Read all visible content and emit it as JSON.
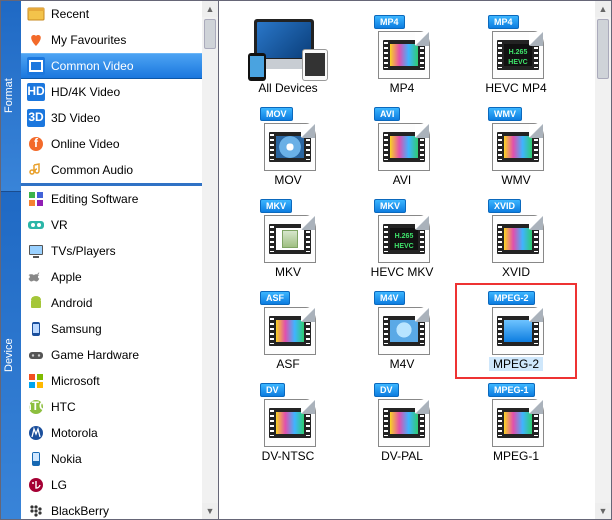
{
  "rails": {
    "format": "Format",
    "device": "Device"
  },
  "sidebar": {
    "format_items": [
      {
        "label": "Recent",
        "icon": "recent-icon"
      },
      {
        "label": "My Favourites",
        "icon": "heart-icon"
      },
      {
        "label": "Common Video",
        "icon": "video-icon",
        "selected": true
      },
      {
        "label": "HD/4K Video",
        "icon": "hd-icon"
      },
      {
        "label": "3D Video",
        "icon": "3d-icon"
      },
      {
        "label": "Online Video",
        "icon": "online-icon"
      },
      {
        "label": "Common Audio",
        "icon": "audio-icon"
      }
    ],
    "device_items": [
      {
        "label": "Editing Software",
        "icon": "editing-icon"
      },
      {
        "label": "VR",
        "icon": "vr-icon"
      },
      {
        "label": "TVs/Players",
        "icon": "tv-icon"
      },
      {
        "label": "Apple",
        "icon": "apple-icon"
      },
      {
        "label": "Android",
        "icon": "android-icon"
      },
      {
        "label": "Samsung",
        "icon": "samsung-icon"
      },
      {
        "label": "Game Hardware",
        "icon": "game-icon"
      },
      {
        "label": "Microsoft",
        "icon": "microsoft-icon"
      },
      {
        "label": "HTC",
        "icon": "htc-icon"
      },
      {
        "label": "Motorola",
        "icon": "motorola-icon"
      },
      {
        "label": "Nokia",
        "icon": "nokia-icon"
      },
      {
        "label": "LG",
        "icon": "lg-icon"
      },
      {
        "label": "BlackBerry",
        "icon": "blackberry-icon"
      }
    ]
  },
  "formats": [
    {
      "badge": "",
      "caption": "All Devices",
      "kind": "alldev"
    },
    {
      "badge": "MP4",
      "caption": "MP4",
      "kind": "film"
    },
    {
      "badge": "MP4",
      "caption": "HEVC MP4",
      "kind": "hevc"
    },
    {
      "badge": "MOV",
      "caption": "MOV",
      "kind": "qt"
    },
    {
      "badge": "AVI",
      "caption": "AVI",
      "kind": "film"
    },
    {
      "badge": "WMV",
      "caption": "WMV",
      "kind": "film"
    },
    {
      "badge": "MKV",
      "caption": "MKV",
      "kind": "mkv"
    },
    {
      "badge": "MKV",
      "caption": "HEVC MKV",
      "kind": "hevc"
    },
    {
      "badge": "XVID",
      "caption": "XVID",
      "kind": "film"
    },
    {
      "badge": "ASF",
      "caption": "ASF",
      "kind": "film"
    },
    {
      "badge": "M4V",
      "caption": "M4V",
      "kind": "itunes"
    },
    {
      "badge": "MPEG-2",
      "caption": "MPEG-2",
      "kind": "mpeg",
      "highlight": true
    },
    {
      "badge": "DV",
      "caption": "DV-NTSC",
      "kind": "film"
    },
    {
      "badge": "DV",
      "caption": "DV-PAL",
      "kind": "film"
    },
    {
      "badge": "MPEG-1",
      "caption": "MPEG-1",
      "kind": "film"
    }
  ]
}
